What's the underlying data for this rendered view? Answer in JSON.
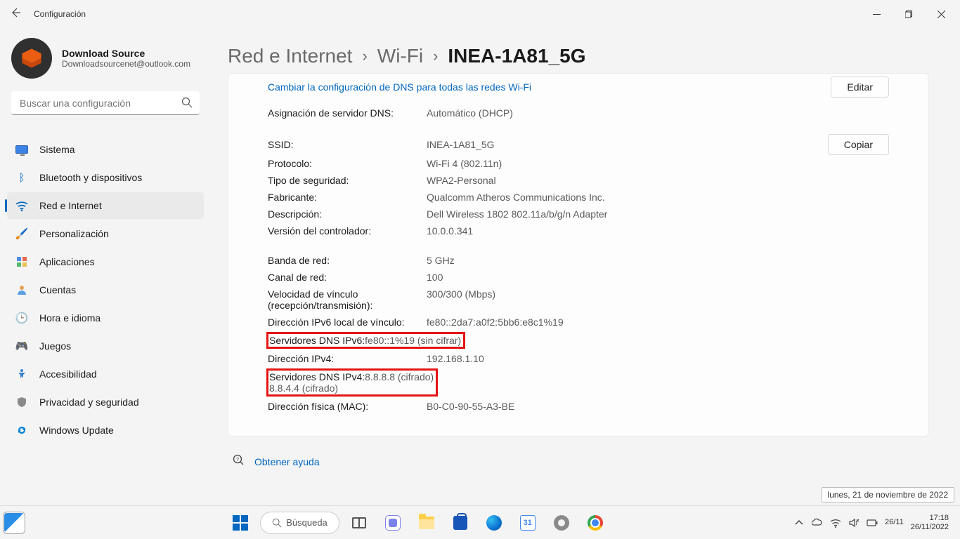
{
  "window": {
    "title": "Configuración"
  },
  "profile": {
    "name": "Download Source",
    "email": "Downloadsourcenet@outlook.com"
  },
  "search": {
    "placeholder": "Buscar una configuración"
  },
  "nav": {
    "items": [
      {
        "label": "Sistema",
        "emoji": "pc"
      },
      {
        "label": "Bluetooth y dispositivos",
        "emoji": "bt"
      },
      {
        "label": "Red e Internet",
        "emoji": "wifi"
      },
      {
        "label": "Personalización",
        "emoji": "brush"
      },
      {
        "label": "Aplicaciones",
        "emoji": "apps"
      },
      {
        "label": "Cuentas",
        "emoji": "user"
      },
      {
        "label": "Hora e idioma",
        "emoji": "time"
      },
      {
        "label": "Juegos",
        "emoji": "game"
      },
      {
        "label": "Accesibilidad",
        "emoji": "acc"
      },
      {
        "label": "Privacidad y seguridad",
        "emoji": "shld"
      },
      {
        "label": "Windows Update",
        "emoji": "upd"
      }
    ],
    "activeIndex": 2
  },
  "breadcrumb": {
    "a": "Red e Internet",
    "b": "Wi-Fi",
    "c": "INEA-1A81_5G"
  },
  "card": {
    "changeDnsLink": "Cambiar la configuración de DNS para todas las redes Wi-Fi",
    "editBtn": "Editar",
    "copyBtn": "Copiar",
    "rows1": [
      {
        "l": "Asignación de servidor DNS:",
        "v": "Automático (DHCP)"
      }
    ],
    "rows2": [
      {
        "l": "SSID:",
        "v": "INEA-1A81_5G"
      },
      {
        "l": "Protocolo:",
        "v": "Wi-Fi 4 (802.11n)"
      },
      {
        "l": "Tipo de seguridad:",
        "v": "WPA2-Personal"
      },
      {
        "l": "Fabricante:",
        "v": "Qualcomm Atheros Communications Inc."
      },
      {
        "l": "Descripción:",
        "v": "Dell Wireless 1802 802.11a/b/g/n Adapter"
      },
      {
        "l": "Versión del controlador:",
        "v": "10.0.0.341"
      }
    ],
    "rows3": [
      {
        "l": "Banda de red:",
        "v": "5 GHz"
      },
      {
        "l": "Canal de red:",
        "v": "100"
      },
      {
        "l": "Velocidad de vínculo (recepción/transmisión):",
        "v": "300/300 (Mbps)"
      },
      {
        "l": "Dirección IPv6 local de vínculo:",
        "v": "fe80::2da7:a0f2:5bb6:e8c1%19"
      },
      {
        "l": "Servidores DNS IPv6:",
        "v": "fe80::1%19 (sin cifrar)",
        "hl": true
      },
      {
        "l": "Dirección IPv4:",
        "v": "192.168.1.10"
      },
      {
        "l": "Servidores DNS IPv4:",
        "v": "8.8.8.8 (cifrado)\n8.8.4.4 (cifrado)",
        "hl": true
      },
      {
        "l": "Dirección física (MAC):",
        "v": "B0-C0-90-55-A3-BE"
      }
    ]
  },
  "help": {
    "label": "Obtener ayuda"
  },
  "taskbar": {
    "searchLabel": "Búsqueda",
    "calDay": "31",
    "tooltip": "lunes, 21 de noviembre de 2022",
    "clock": {
      "time": "17:18",
      "d1": "26/11",
      "d2": "26/11/2022"
    }
  }
}
